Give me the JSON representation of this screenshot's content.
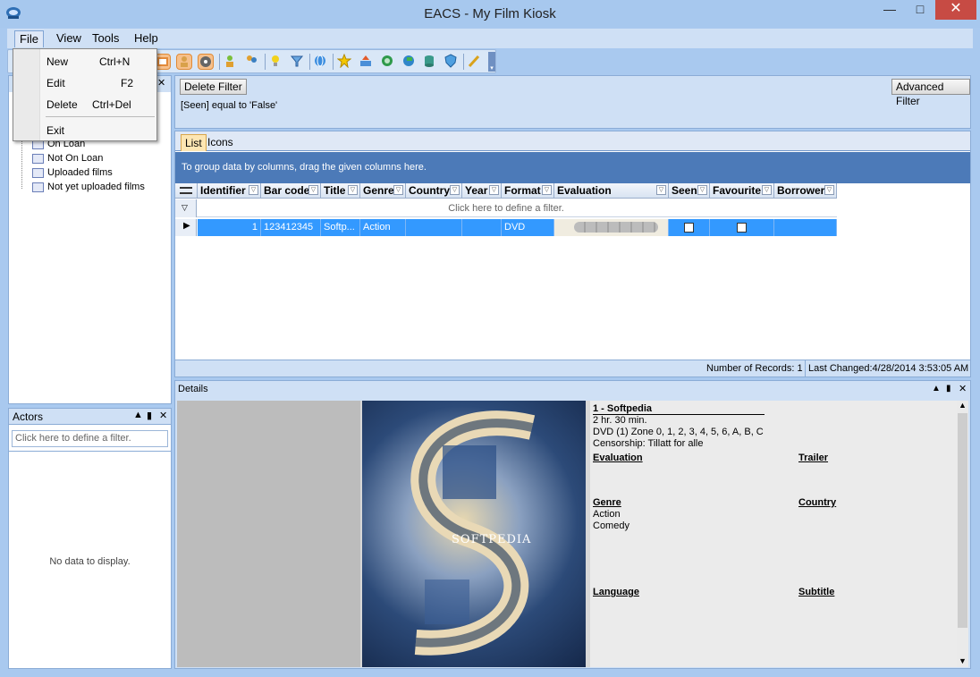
{
  "window": {
    "title": "EACS - My Film Kiosk",
    "minimize": "—",
    "maximize": "□",
    "close": "✕"
  },
  "menubar": {
    "file": "File",
    "view": "View",
    "tools": "Tools",
    "help": "Help"
  },
  "file_menu": {
    "items": [
      {
        "label": "New",
        "shortcut": "Ctrl+N"
      },
      {
        "label": "Edit",
        "shortcut": "F2"
      },
      {
        "label": "Delete",
        "shortcut": "Ctrl+Del"
      },
      {
        "label": "Exit",
        "shortcut": ""
      }
    ]
  },
  "tree": {
    "items": [
      "On Loan",
      "Not On Loan",
      "Uploaded films",
      "Not yet uploaded films"
    ]
  },
  "actors_panel": {
    "title": "Actors",
    "filter_placeholder": "Click here to define a filter.",
    "empty_text": "No data to display."
  },
  "filter": {
    "delete_button": "Delete Filter",
    "advanced_button": "Advanced Filter",
    "expression": "[Seen] equal to 'False'"
  },
  "view_tabs": {
    "list": "List",
    "icons": "Icons"
  },
  "grid": {
    "group_hint": "To group data by columns, drag the given columns here.",
    "columns": [
      "Identifier",
      "Bar code",
      "Title",
      "Genre",
      "Country",
      "Year",
      "Format",
      "Evaluation",
      "Seen",
      "Favourite",
      "Borrower"
    ],
    "filter_row_text": "Click here to define a filter.",
    "rows": [
      {
        "identifier": "1",
        "barcode": "123412345",
        "title": "Softp...",
        "genre": "Action",
        "country": "",
        "year": "",
        "format": "DVD",
        "evaluation": 0,
        "seen": false,
        "favourite": false,
        "borrower": ""
      }
    ]
  },
  "status": {
    "records": "Number of Records: 1",
    "last_changed": "Last Changed:4/28/2014 3:53:05 AM"
  },
  "details": {
    "panel_title": "Details",
    "film_title": "1 - Softpedia",
    "duration": "2 hr. 30 min.",
    "media": "DVD (1) Zone 0, 1, 2, 3, 4, 5, 6, A, B, C",
    "censorship": "Censorship: Tillatt for alle",
    "evaluation_label": "Evaluation",
    "trailer_label": "Trailer",
    "genre_label": "Genre",
    "genres": [
      "Action",
      "Comedy"
    ],
    "country_label": "Country",
    "language_label": "Language",
    "subtitle_label": "Subtitle",
    "poster_text": "SOFTPEDIA"
  },
  "colors": {
    "selection": "#3399ff",
    "group_band": "#4c7ab8",
    "close_button": "#c74b44",
    "panel": "#cfe0f5"
  }
}
